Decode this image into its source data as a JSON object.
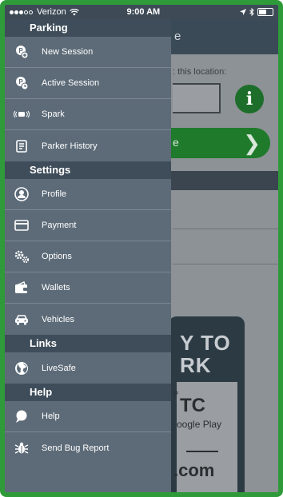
{
  "status_bar": {
    "carrier": "Verizon",
    "time": "9:00 AM"
  },
  "background": {
    "header_partial": "e",
    "location_prompt_partial": ": this location:",
    "button_partial": "e",
    "poster": {
      "line1": "Y TO",
      "line2": "RK",
      "line3": "TC",
      "line4": "oogle Play",
      "line5": ".com",
      "line6": "P"
    }
  },
  "drawer": {
    "sections": [
      {
        "title": "Parking",
        "items": [
          {
            "label": "New Session",
            "icon": "new-session-icon"
          },
          {
            "label": "Active Session",
            "icon": "active-session-icon"
          },
          {
            "label": "Spark",
            "icon": "spark-icon"
          },
          {
            "label": "Parker History",
            "icon": "history-icon"
          }
        ]
      },
      {
        "title": "Settings",
        "items": [
          {
            "label": "Profile",
            "icon": "profile-icon"
          },
          {
            "label": "Payment",
            "icon": "payment-icon"
          },
          {
            "label": "Options",
            "icon": "options-gears-icon"
          },
          {
            "label": "Wallets",
            "icon": "wallet-icon"
          },
          {
            "label": "Vehicles",
            "icon": "car-icon"
          }
        ]
      },
      {
        "title": "Links",
        "items": [
          {
            "label": "LiveSafe",
            "icon": "globe-icon"
          }
        ]
      },
      {
        "title": "Help",
        "items": [
          {
            "label": "Help",
            "icon": "help-icon"
          },
          {
            "label": "Send Bug Report",
            "icon": "bug-icon"
          }
        ]
      }
    ]
  },
  "colors": {
    "frame_border": "#2f9a3a",
    "drawer_bg": "#5d6b78",
    "section_bg": "#3f4d5a",
    "accent_green": "#1f7a2c"
  }
}
